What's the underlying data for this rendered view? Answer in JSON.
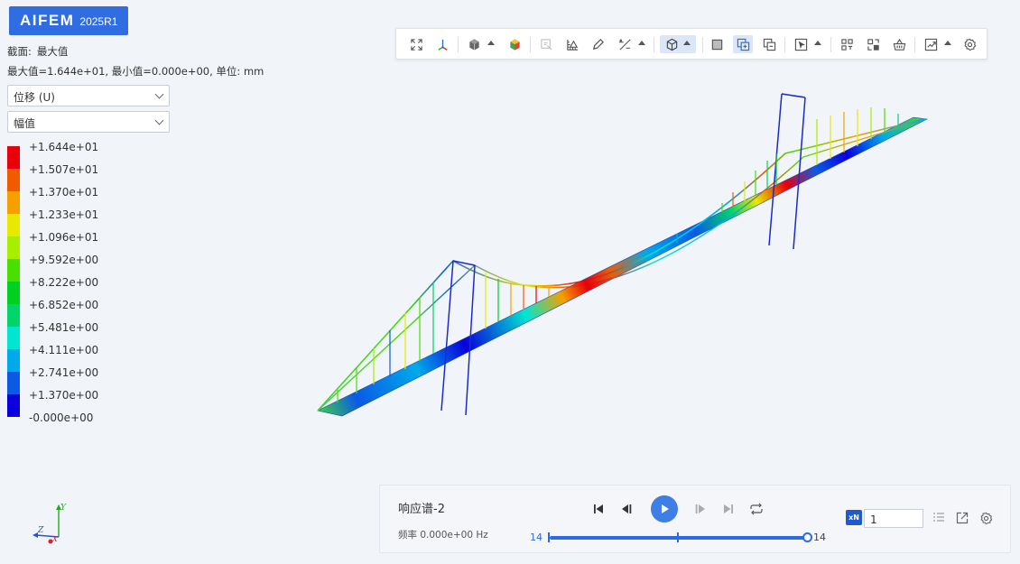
{
  "app": {
    "brand": "AIFEM",
    "version": "2025R1"
  },
  "result_info": {
    "section_label": "截面:",
    "section_value": "最大值",
    "range_text": "最大值=1.644e+01, 最小值=0.000e+00, 单位: mm"
  },
  "selects": {
    "result_type": "位移 (U)",
    "component": "幅值"
  },
  "legend": {
    "colors": [
      "#e8000a",
      "#f25a00",
      "#f5a000",
      "#e7ea00",
      "#a8ee00",
      "#48e000",
      "#00d020",
      "#00d46a",
      "#00e6d0",
      "#00aaea",
      "#0a5ae6",
      "#0a00dc"
    ],
    "labels": [
      "+1.644e+01",
      "+1.507e+01",
      "+1.370e+01",
      "+1.233e+01",
      "+1.096e+01",
      "+9.592e+00",
      "+8.222e+00",
      "+6.852e+00",
      "+5.481e+00",
      "+4.111e+00",
      "+2.741e+00",
      "+1.370e+00",
      "-0.000e+00"
    ]
  },
  "toolbar": {
    "items": [
      "fit-view",
      "coordinate-axes",
      "display-style",
      "shading-mode",
      "probe",
      "ruler",
      "pen-annotation",
      "max-min-label",
      "view-orientation",
      "fill-mode",
      "overlay-view",
      "compare-view",
      "selection-mode",
      "grid-split",
      "split-view",
      "basket",
      "export-image",
      "settings"
    ]
  },
  "axis": {
    "y": "Y",
    "z": "Z",
    "x": "X"
  },
  "player": {
    "title": "响应谱-2",
    "frequency": "频率 0.000e+00 Hz",
    "slider_min": "14",
    "slider_max": "14",
    "speed_icon": "xN",
    "speed_value": "1"
  },
  "colors": {
    "accent": "#2f6de0",
    "play": "#3e7ee5"
  }
}
